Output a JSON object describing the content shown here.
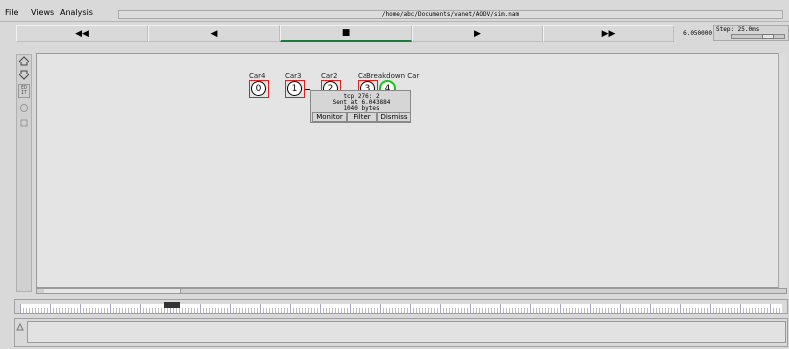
{
  "menu": {
    "file": "File",
    "views": "Views",
    "analysis": "Analysis"
  },
  "window": {
    "path": "/home/abc/Documents/vanet/AODV/sim.nam"
  },
  "transport": {
    "rewind": "◀◀",
    "back": "◀",
    "stop": "■",
    "play": "▶",
    "forward": "▶▶",
    "active": "stop",
    "active_color": "#1d7a3a"
  },
  "time": "6.050000",
  "step": {
    "label": "Step: 25.0ms"
  },
  "tools": [
    "zoom-in-icon",
    "zoom-out-icon",
    "editor-icon",
    "circle-icon",
    "square-icon"
  ],
  "cars": [
    {
      "label": "Car4",
      "id": "0",
      "highlight": "#e02020"
    },
    {
      "label": "Car3",
      "id": "1",
      "highlight": "#e02020"
    },
    {
      "label": "Car2",
      "id": "2",
      "highlight": "#e02020"
    },
    {
      "label": "Car1",
      "id": "3",
      "highlight": "#e02020"
    },
    {
      "label": "Breakdown Car",
      "id": "4",
      "highlight": "#18c418"
    }
  ],
  "popup": {
    "line1": "tcp 276: 2",
    "line2": "Sent at 6.043884",
    "line3": "1040 bytes",
    "monitor": "Monitor",
    "filter": "Filter",
    "dismiss": "Dismiss"
  },
  "timeline": {
    "progress": 0.2
  }
}
